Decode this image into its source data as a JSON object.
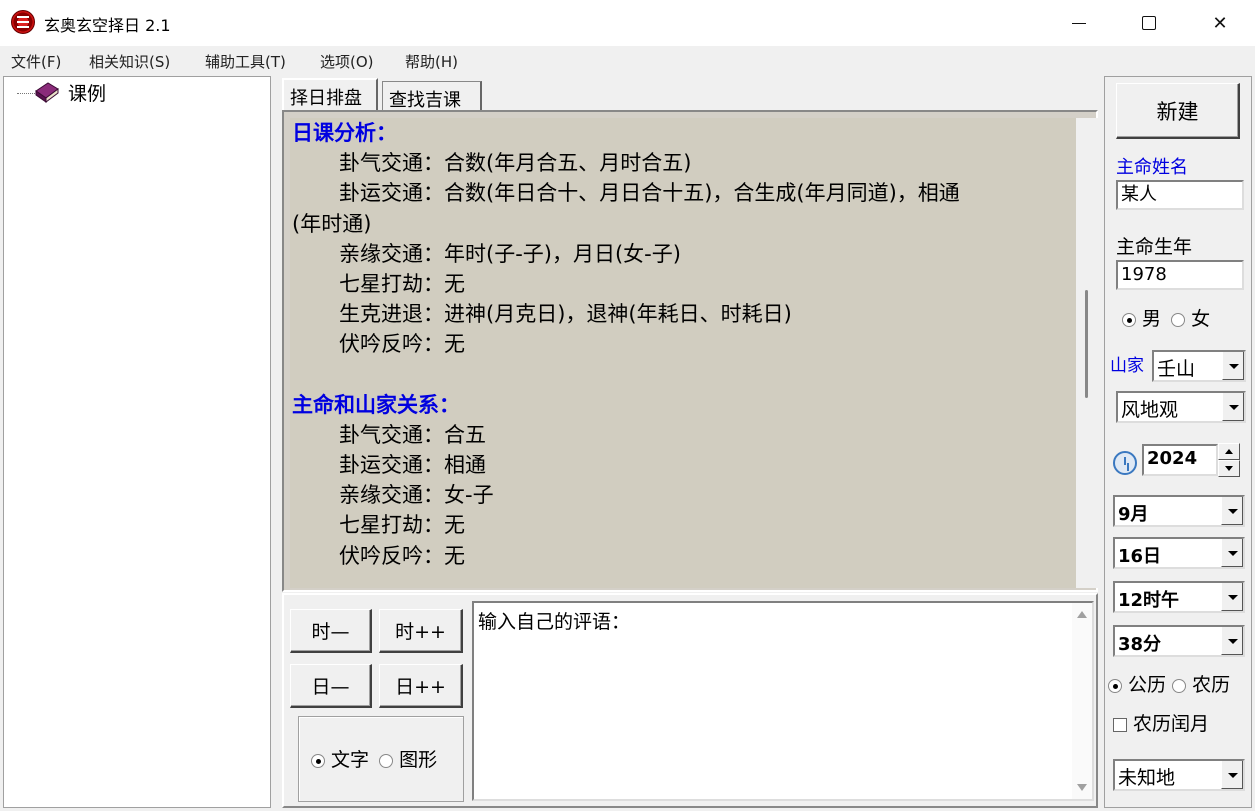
{
  "window": {
    "title": "玄奥玄空择日 2.1"
  },
  "menu": [
    "文件(F)",
    "相关知识(S)",
    "辅助工具(T)",
    "选项(O)",
    "帮助(H)"
  ],
  "tree": {
    "root_label": "课例"
  },
  "tabs": [
    {
      "label": "择日排盘"
    },
    {
      "label": "查找吉课"
    }
  ],
  "analysis": {
    "section1_title": "日课分析：",
    "section1_lines": [
      "卦气交通：合数(年月合五、月时合五)",
      "卦运交通：合数(年日合十、月日合十五)，合生成(年月同道)，相通",
      "(年时通)",
      "亲缘交通：年时(子-子)，月日(女-子)",
      "七星打劫：无",
      "生克进退：进神(月克日)，退神(年耗日、时耗日)",
      "伏吟反吟：无"
    ],
    "section2_title": "主命和山家关系：",
    "section2_lines": [
      "卦气交通：合五",
      "卦运交通：相通",
      "亲缘交通：女-子",
      "七星打劫：无",
      "伏吟反吟：无"
    ]
  },
  "controls": {
    "hour_minus": "时—",
    "hour_plus": "时++",
    "day_minus": "日—",
    "day_plus": "日++",
    "mode_text": "文字",
    "mode_graphic": "图形"
  },
  "comment": {
    "text": "输入自己的评语："
  },
  "right": {
    "new_button": "新建",
    "owner_name_label": "主命姓名",
    "owner_name_value": "某人",
    "birth_year_label": "主命生年",
    "birth_year_value": "1978",
    "gender_male": "男",
    "gender_female": "女",
    "mountain_label": "山家",
    "mountain_value": "壬山",
    "gua_value": "风地观",
    "year_value": "2024",
    "month_value": "9月",
    "day_value": "16日",
    "hour_value": "12时午",
    "minute_value": "38分",
    "cal_solar": "公历",
    "cal_lunar": "农历",
    "leap_month": "农历闰月",
    "location_value": "未知地"
  }
}
